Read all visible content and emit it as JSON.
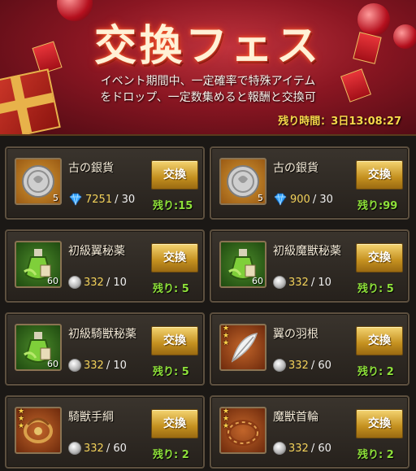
{
  "banner": {
    "title": "交換フェス",
    "description_line1": "イベント期間中、一定確率で特殊アイテム",
    "description_line2": "をドロップ、一定数集めると報酬と交換可",
    "time_label": "残り時間：",
    "time_value": "3日13:08:27"
  },
  "items": [
    {
      "name": "古の銀貨",
      "icon": "silver-coin-icon",
      "frame": "gold",
      "count": "5",
      "stars": 0,
      "currency": "gem-icon",
      "have": "7251",
      "need": "/ 30",
      "button": "交換",
      "remain": "残り:15"
    },
    {
      "name": "古の銀貨",
      "icon": "silver-coin-icon",
      "frame": "gold",
      "count": "5",
      "stars": 0,
      "currency": "gem-icon",
      "have": "900",
      "need": "/ 30",
      "button": "交換",
      "remain": "残り:99"
    },
    {
      "name": "初級翼秘薬",
      "icon": "potion-icon",
      "frame": "green",
      "count": "60",
      "stars": 0,
      "currency": "silver-coin-icon",
      "have": "332",
      "need": "/ 10",
      "button": "交換",
      "remain": "残り: 5"
    },
    {
      "name": "初級魔獣秘薬",
      "icon": "potion-icon",
      "frame": "green",
      "count": "60",
      "stars": 0,
      "currency": "silver-coin-icon",
      "have": "332",
      "need": "/ 10",
      "button": "交換",
      "remain": "残り: 5"
    },
    {
      "name": "初級騎獣秘薬",
      "icon": "potion-icon",
      "frame": "green",
      "count": "60",
      "stars": 0,
      "currency": "silver-coin-icon",
      "have": "332",
      "need": "/ 10",
      "button": "交換",
      "remain": "残り: 5"
    },
    {
      "name": "翼の羽根",
      "icon": "feather-icon",
      "frame": "orange",
      "count": "",
      "stars": 3,
      "currency": "silver-coin-icon",
      "have": "332",
      "need": "/ 60",
      "button": "交換",
      "remain": "残り: 2"
    },
    {
      "name": "騎獣手綱",
      "icon": "reins-icon",
      "frame": "orange",
      "count": "",
      "stars": 3,
      "currency": "silver-coin-icon",
      "have": "332",
      "need": "/ 60",
      "button": "交換",
      "remain": "残り: 2"
    },
    {
      "name": "魔獣首輪",
      "icon": "collar-icon",
      "frame": "orange",
      "count": "",
      "stars": 3,
      "currency": "silver-coin-icon",
      "have": "332",
      "need": "/ 60",
      "button": "交換",
      "remain": "残り: 2"
    }
  ]
}
